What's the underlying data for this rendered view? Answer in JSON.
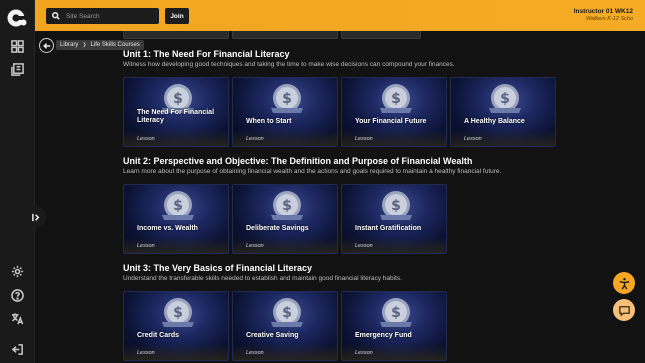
{
  "topbar": {
    "search_placeholder": "Site Search",
    "join_label": "Join",
    "user_name": "Instructor 01 WK12",
    "user_org": "Walkers K-12 Scho"
  },
  "breadcrumb": {
    "items": [
      "Library",
      "Life Skills Courses"
    ]
  },
  "units": [
    {
      "title": "Unit 1: The Need For Financial Literacy",
      "description": "Witness how developing good techniques and taking the time to make wise decisions can compound your finances.",
      "lessons": [
        {
          "title": "The Need For Financial Literacy",
          "kind": "Lesson"
        },
        {
          "title": "When to Start",
          "kind": "Lesson"
        },
        {
          "title": "Your Financial Future",
          "kind": "Lesson"
        },
        {
          "title": "A Healthy Balance",
          "kind": "Lesson"
        }
      ]
    },
    {
      "title": "Unit 2: Perspective and Objective: The Definition and Purpose of Financial Wealth",
      "description": "Learn more about the purpose of obtaining financial wealth and the actions and goals required to maintain a healthy financial future.",
      "lessons": [
        {
          "title": "Income vs. Wealth",
          "kind": "Lesson"
        },
        {
          "title": "Deliberate Savings",
          "kind": "Lesson"
        },
        {
          "title": "Instant Gratification",
          "kind": "Lesson"
        }
      ]
    },
    {
      "title": "Unit 3: The Very Basics of Financial Literacy",
      "description": "Understand the transferable skills needed to establish and maintain good financial literacy habits.",
      "lessons": [
        {
          "title": "Credit Cards",
          "kind": "Lesson"
        },
        {
          "title": "Creative Saving",
          "kind": "Lesson"
        },
        {
          "title": "Emergency Fund",
          "kind": "Lesson"
        }
      ]
    }
  ],
  "colors": {
    "accent": "#f5a623",
    "card_blue": "#1c2760",
    "chat_fab": "#f7c07a"
  }
}
